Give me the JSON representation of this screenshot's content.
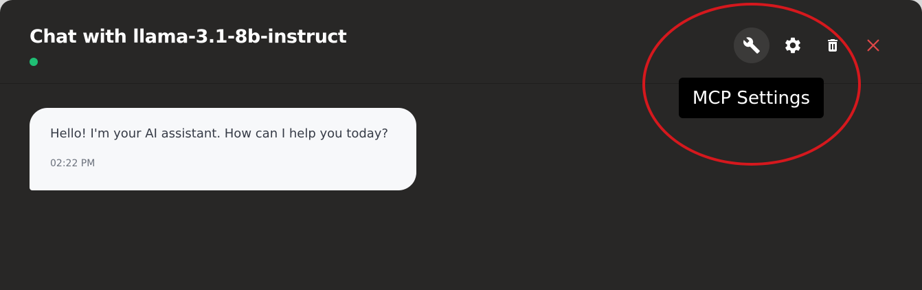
{
  "header": {
    "title": "Chat with llama-3.1-8b-instruct",
    "status_color": "#1fbf74",
    "status": "online"
  },
  "toolbar": {
    "buttons": [
      {
        "icon": "wrench-icon",
        "action": "mcp-settings",
        "active": true
      },
      {
        "icon": "gear-icon",
        "action": "settings"
      },
      {
        "icon": "trash-icon",
        "action": "delete"
      },
      {
        "icon": "close-icon",
        "action": "close",
        "color": "#e04848"
      }
    ],
    "tooltip": "MCP Settings"
  },
  "annotation": {
    "highlight_color": "#d5181d"
  },
  "messages": [
    {
      "role": "assistant",
      "text": "Hello! I'm your AI assistant. How can I help you today?",
      "time": "02:22 PM"
    }
  ],
  "colors": {
    "background": "#282726",
    "bubble": "#f7f8fa",
    "tooltip_bg": "#000000"
  }
}
